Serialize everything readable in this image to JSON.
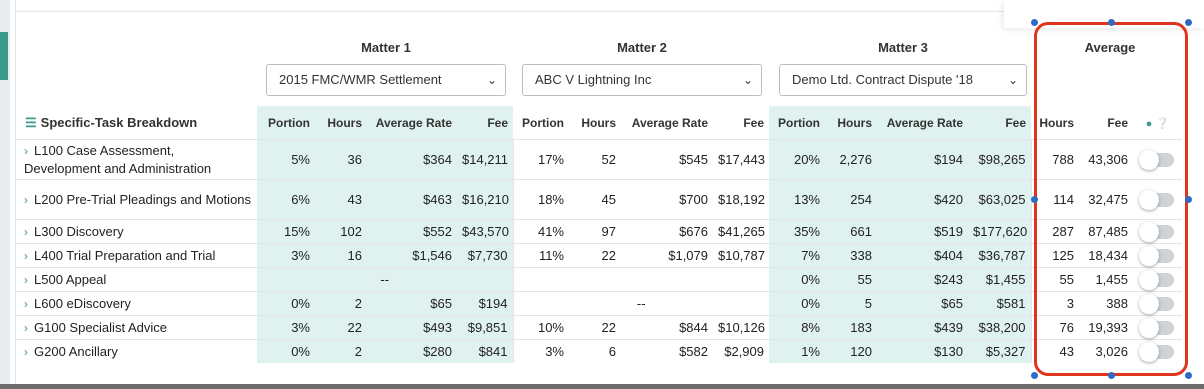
{
  "matters": [
    {
      "header": "Matter 1",
      "selected": "2015 FMC/WMR Settlement"
    },
    {
      "header": "Matter 2",
      "selected": "ABC V Lightning Inc"
    },
    {
      "header": "Matter 3",
      "selected": "Demo Ltd. Contract Dispute '18"
    }
  ],
  "average_header": "Average",
  "columns": {
    "task": "Specific-Task Breakdown",
    "portion": "Portion",
    "hours": "Hours",
    "avg_rate": "Average Rate",
    "fee": "Fee"
  },
  "rows": [
    {
      "task": "L100 Case Assessment, Development and Administration",
      "m1": [
        "5%",
        "36",
        "$364",
        "$14,211"
      ],
      "m2": [
        "17%",
        "52",
        "$545",
        "$17,443"
      ],
      "m3": [
        "20%",
        "2,276",
        "$194",
        "$98,265"
      ],
      "avg": [
        "788",
        "43,306"
      ]
    },
    {
      "task": "L200 Pre-Trial Pleadings and Motions",
      "m1": [
        "6%",
        "43",
        "$463",
        "$16,210"
      ],
      "m2": [
        "18%",
        "45",
        "$700",
        "$18,192"
      ],
      "m3": [
        "13%",
        "254",
        "$420",
        "$63,025"
      ],
      "avg": [
        "114",
        "32,475"
      ]
    },
    {
      "task": "L300 Discovery",
      "m1": [
        "15%",
        "102",
        "$552",
        "$43,570"
      ],
      "m2": [
        "41%",
        "97",
        "$676",
        "$41,265"
      ],
      "m3": [
        "35%",
        "661",
        "$519",
        "$177,620"
      ],
      "avg": [
        "287",
        "87,485"
      ]
    },
    {
      "task": "L400 Trial Preparation and Trial",
      "m1": [
        "3%",
        "16",
        "$1,546",
        "$7,730"
      ],
      "m2": [
        "11%",
        "22",
        "$1,079",
        "$10,787"
      ],
      "m3": [
        "7%",
        "338",
        "$404",
        "$36,787"
      ],
      "avg": [
        "125",
        "18,434"
      ]
    },
    {
      "task": "L500 Appeal",
      "m1_dash": "--",
      "m2_dash": "",
      "m3": [
        "0%",
        "55",
        "$243",
        "$1,455"
      ],
      "avg": [
        "55",
        "1,455"
      ]
    },
    {
      "task": "L600 eDiscovery",
      "m1": [
        "0%",
        "2",
        "$65",
        "$194"
      ],
      "m2_dash": "--",
      "m3": [
        "0%",
        "5",
        "$65",
        "$581"
      ],
      "avg": [
        "3",
        "388"
      ]
    },
    {
      "task": "G100 Specialist Advice",
      "m1": [
        "3%",
        "22",
        "$493",
        "$9,851"
      ],
      "m2": [
        "10%",
        "22",
        "$844",
        "$10,126"
      ],
      "m3": [
        "8%",
        "183",
        "$439",
        "$38,200"
      ],
      "avg": [
        "76",
        "19,393"
      ]
    },
    {
      "task": "G200 Ancillary",
      "m1": [
        "0%",
        "2",
        "$280",
        "$841"
      ],
      "m2": [
        "3%",
        "6",
        "$582",
        "$2,909"
      ],
      "m3": [
        "1%",
        "120",
        "$130",
        "$5,327"
      ],
      "avg": [
        "43",
        "3,026"
      ]
    }
  ],
  "icons": {
    "list": "list-icon",
    "expand": "chevron-right-icon",
    "user": "user-icon",
    "help": "help-icon",
    "dropdown": "chevron-down-icon"
  },
  "colors": {
    "accent": "#3c9a8a",
    "tint": "#e0f2ef",
    "highlight": "#e0341c",
    "handle": "#2d6cc6"
  }
}
